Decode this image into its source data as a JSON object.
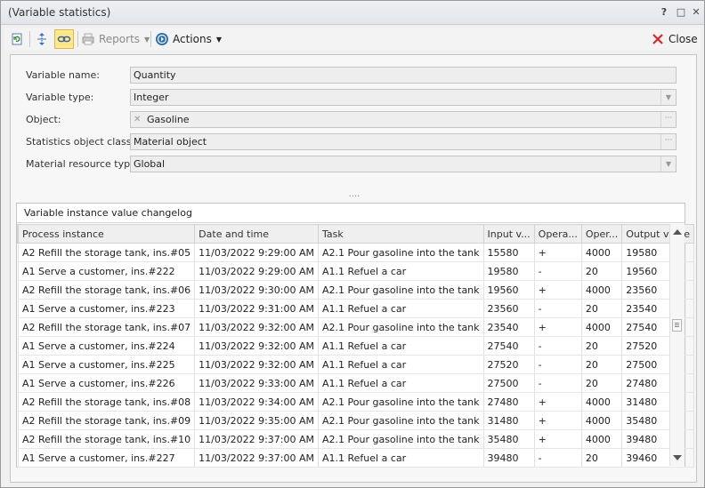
{
  "window": {
    "title": "(Variable statistics)",
    "help_glyph": "?",
    "restore_glyph": "□",
    "close_glyph": "✕"
  },
  "toolbar": {
    "reports_label": "Reports",
    "actions_label": "Actions",
    "close_label": "Close",
    "accent_close": "#d62b2b"
  },
  "form": {
    "variable_name": {
      "label": "Variable name:",
      "value": "Quantity"
    },
    "variable_type": {
      "label": "Variable type:",
      "value": "Integer"
    },
    "object": {
      "label": "Object:",
      "value": "Gasoline"
    },
    "stats_class": {
      "label": "Statistics object class:",
      "value": "Material object"
    },
    "resource_type": {
      "label": "Material resource type:",
      "value": "Global"
    }
  },
  "changelog": {
    "title": "Variable instance value changelog",
    "columns": [
      "Process instance",
      "Date and time",
      "Task",
      "Input v...",
      "Opera...",
      "Oper...",
      "Output value"
    ],
    "rows": [
      [
        "A2 Refill the storage tank, ins.#05",
        "11/03/2022 9:29:00 AM",
        "A2.1 Pour gasoline into the tank",
        "15580",
        "+",
        "4000",
        "19580"
      ],
      [
        "A1 Serve a customer, ins.#222",
        "11/03/2022 9:29:00 AM",
        "A1.1 Refuel a car",
        "19580",
        "-",
        "20",
        "19560"
      ],
      [
        "A2 Refill the storage tank, ins.#06",
        "11/03/2022 9:30:00 AM",
        "A2.1 Pour gasoline into the tank",
        "19560",
        "+",
        "4000",
        "23560"
      ],
      [
        "A1 Serve a customer, ins.#223",
        "11/03/2022 9:31:00 AM",
        "A1.1 Refuel a car",
        "23560",
        "-",
        "20",
        "23540"
      ],
      [
        "A2 Refill the storage tank, ins.#07",
        "11/03/2022 9:32:00 AM",
        "A2.1 Pour gasoline into the tank",
        "23540",
        "+",
        "4000",
        "27540"
      ],
      [
        "A1 Serve a customer, ins.#224",
        "11/03/2022 9:32:00 AM",
        "A1.1 Refuel a car",
        "27540",
        "-",
        "20",
        "27520"
      ],
      [
        "A1 Serve a customer, ins.#225",
        "11/03/2022 9:32:00 AM",
        "A1.1 Refuel a car",
        "27520",
        "-",
        "20",
        "27500"
      ],
      [
        "A1 Serve a customer, ins.#226",
        "11/03/2022 9:33:00 AM",
        "A1.1 Refuel a car",
        "27500",
        "-",
        "20",
        "27480"
      ],
      [
        "A2 Refill the storage tank, ins.#08",
        "11/03/2022 9:34:00 AM",
        "A2.1 Pour gasoline into the tank",
        "27480",
        "+",
        "4000",
        "31480"
      ],
      [
        "A2 Refill the storage tank, ins.#09",
        "11/03/2022 9:35:00 AM",
        "A2.1 Pour gasoline into the tank",
        "31480",
        "+",
        "4000",
        "35480"
      ],
      [
        "A2 Refill the storage tank, ins.#10",
        "11/03/2022 9:37:00 AM",
        "A2.1 Pour gasoline into the tank",
        "35480",
        "+",
        "4000",
        "39480"
      ],
      [
        "A1 Serve a customer, ins.#227",
        "11/03/2022 9:37:00 AM",
        "A1.1 Refuel a car",
        "39480",
        "-",
        "20",
        "39460"
      ]
    ]
  }
}
